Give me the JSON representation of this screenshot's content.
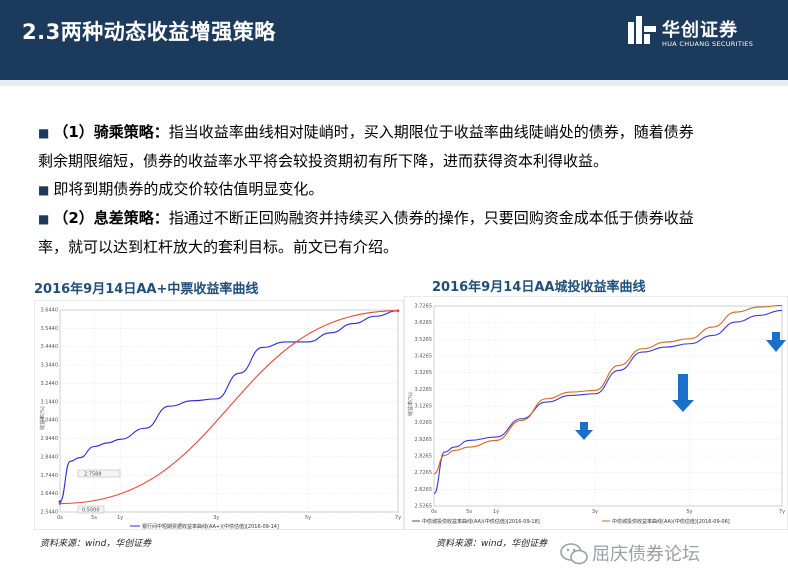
{
  "header": {
    "title": "2.3两种动态收益增强策略",
    "logo_cn": "华创证券",
    "logo_en": "HUA CHUANG SECURITIES"
  },
  "paragraphs": {
    "p1_label": "（1）骑乘策略：",
    "p1_text_a": "指当收益率曲线相对陡峭时，买入期限位于收益率曲线陡峭处的债券，随着债券",
    "p1_text_b": "剩余期限缩短，债券的收益率水平将会较投资期初有所下降，进而获得资本利得收益。",
    "p2_text": "即将到期债券的成交价较估值明显变化。",
    "p3_label": "（2）息差策略：",
    "p3_text_a": "指通过不断正回购融资并持续买入债券的操作，只要回购资金成本低于债券收益",
    "p3_text_b": "率，就可以达到杠杆放大的套利目标。前文已有介绍。"
  },
  "charts_meta": {
    "left_title": "2016年9月14日AA+中票收益率曲线",
    "right_title": "2016年9月14日AA城投收益率曲线",
    "left_source": "资料来源：wind，华创证券",
    "right_source": "资料来源：wind，华创证券",
    "left_legend_1": "银行间中短期票据收益率曲线(AA+)(中债估值)[2016-09-14]",
    "right_legend_1": "中债城投债收益率曲线(AA)(中债估值)[2016-09-18]",
    "right_legend_2": "中债城投债收益率曲线(AA)(中债估值)[2016-09-06]",
    "left_ylabel": "收益率(%)",
    "right_ylabel": "收益率(%)",
    "left_annot_1": "2.7588",
    "left_annot_2": "0.5000"
  },
  "chart_data": [
    {
      "type": "line",
      "title": "2016年9月14日AA+中票收益率曲线",
      "ylabel": "收益率(%)",
      "xticks": [
        "0s",
        "5s",
        "1y",
        "3y",
        "5y",
        "7y"
      ],
      "x_positions_years": [
        0,
        0.5,
        1,
        3,
        5,
        7
      ],
      "yticks": [
        "2.5440",
        "2.6440",
        "2.7440",
        "2.8440",
        "2.9440",
        "3.0440",
        "3.1440",
        "3.2440",
        "3.3440",
        "3.4440",
        "3.5440",
        "3.6440"
      ],
      "ylim": [
        2.544,
        3.644
      ],
      "series": [
        {
          "name": "银行间中短期票据收益率曲线(AA+)(中债估值)[2016-09-14]",
          "color": "#2b2bd8",
          "points": [
            [
              0,
              2.6
            ],
            [
              0.1,
              2.82
            ],
            [
              0.25,
              2.84
            ],
            [
              0.5,
              2.9
            ],
            [
              0.75,
              2.92
            ],
            [
              1,
              2.94
            ],
            [
              1.5,
              3.0
            ],
            [
              2,
              3.12
            ],
            [
              2.5,
              3.15
            ],
            [
              3,
              3.16
            ],
            [
              3.5,
              3.3
            ],
            [
              4,
              3.44
            ],
            [
              4.5,
              3.47
            ],
            [
              5,
              3.47
            ],
            [
              5.5,
              3.52
            ],
            [
              6,
              3.57
            ],
            [
              6.5,
              3.61
            ],
            [
              7,
              3.64
            ]
          ]
        },
        {
          "name": "",
          "color": "#e8473b",
          "points": [
            [
              0,
              2.59
            ],
            [
              7,
              3.64
            ]
          ]
        }
      ]
    },
    {
      "type": "line",
      "title": "2016年9月14日AA城投收益率曲线",
      "ylabel": "收益率(%)",
      "xticks": [
        "0s",
        "5s",
        "1y",
        "3y",
        "5y",
        "7y"
      ],
      "x_positions_years": [
        0,
        0.5,
        1,
        3,
        5,
        7
      ],
      "yticks": [
        "2.5265",
        "2.6265",
        "2.7265",
        "2.8265",
        "2.9265",
        "3.0265",
        "3.1265",
        "3.2265",
        "3.3265",
        "3.4265",
        "3.5265",
        "3.6265",
        "3.7265"
      ],
      "ylim": [
        2.5265,
        3.7265
      ],
      "series": [
        {
          "name": "中债城投债收益率曲线(AA)(中债估值)[2016-09-18]",
          "color": "#3b3bd6",
          "points": [
            [
              0,
              2.6
            ],
            [
              0.1,
              2.85
            ],
            [
              0.25,
              2.88
            ],
            [
              0.5,
              2.92
            ],
            [
              1,
              2.94
            ],
            [
              1.5,
              3.05
            ],
            [
              2,
              3.15
            ],
            [
              2.5,
              3.19
            ],
            [
              3,
              3.2
            ],
            [
              3.5,
              3.34
            ],
            [
              4,
              3.45
            ],
            [
              4.5,
              3.48
            ],
            [
              5,
              3.5
            ],
            [
              5.5,
              3.55
            ],
            [
              6,
              3.63
            ],
            [
              6.5,
              3.67
            ],
            [
              7,
              3.7
            ]
          ]
        },
        {
          "name": "中债城投债收益率曲线(AA)(中债估值)[2016-09-06]",
          "color": "#d2691e",
          "points": [
            [
              0,
              2.72
            ],
            [
              0.1,
              2.83
            ],
            [
              0.25,
              2.86
            ],
            [
              0.5,
              2.88
            ],
            [
              1,
              2.92
            ],
            [
              1.5,
              3.04
            ],
            [
              2,
              3.17
            ],
            [
              2.5,
              3.21
            ],
            [
              3,
              3.22
            ],
            [
              3.5,
              3.37
            ],
            [
              4,
              3.47
            ],
            [
              4.5,
              3.51
            ],
            [
              5,
              3.53
            ],
            [
              5.5,
              3.6
            ],
            [
              6,
              3.69
            ],
            [
              6.5,
              3.72
            ],
            [
              7,
              3.73
            ]
          ]
        }
      ],
      "annotations": [
        "down-arrow-near-3y",
        "down-arrow-near-5y",
        "down-arrow-near-7y"
      ]
    }
  ],
  "watermark": {
    "text": "屈庆债券论坛"
  },
  "colors": {
    "header_bg": "#1b3a5c",
    "title_blue": "#1f4e79",
    "arrow_blue": "#1a6fc9"
  }
}
